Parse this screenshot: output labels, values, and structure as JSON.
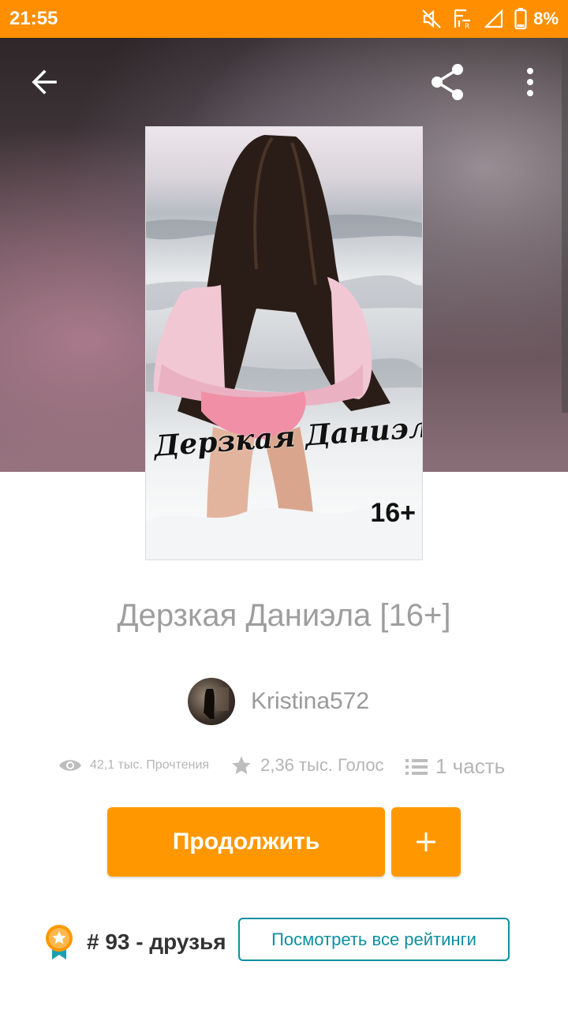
{
  "status_bar": {
    "time": "21:55",
    "battery_percent": "8%",
    "icons": [
      "mute-icon",
      "signal-no-sim-icon",
      "cell-signal-icon",
      "battery-icon"
    ]
  },
  "toolbar": {
    "back_icon": "arrow-left-icon",
    "share_icon": "share-icon",
    "more_icon": "more-vertical-icon"
  },
  "cover": {
    "title_text": "Дерзкая Даниэла",
    "age_text": "16+"
  },
  "story": {
    "title": "Дерзкая Даниэла [16+]"
  },
  "author": {
    "name": "Kristina572"
  },
  "stats": {
    "reads": "42,1 тыс. Прочтения",
    "votes": "2,36 тыс. Голос",
    "parts": "1 часть"
  },
  "actions": {
    "continue_label": "Продолжить",
    "add_label": "+"
  },
  "ranking": {
    "text": "# 93 - друзья",
    "view_all_label": "Посмотреть все рейтинги"
  },
  "colors": {
    "status_bar": "#ff8f00",
    "accent": "#ff9800",
    "link": "#0e8fa0",
    "muted_text": "#9e9e9e"
  }
}
